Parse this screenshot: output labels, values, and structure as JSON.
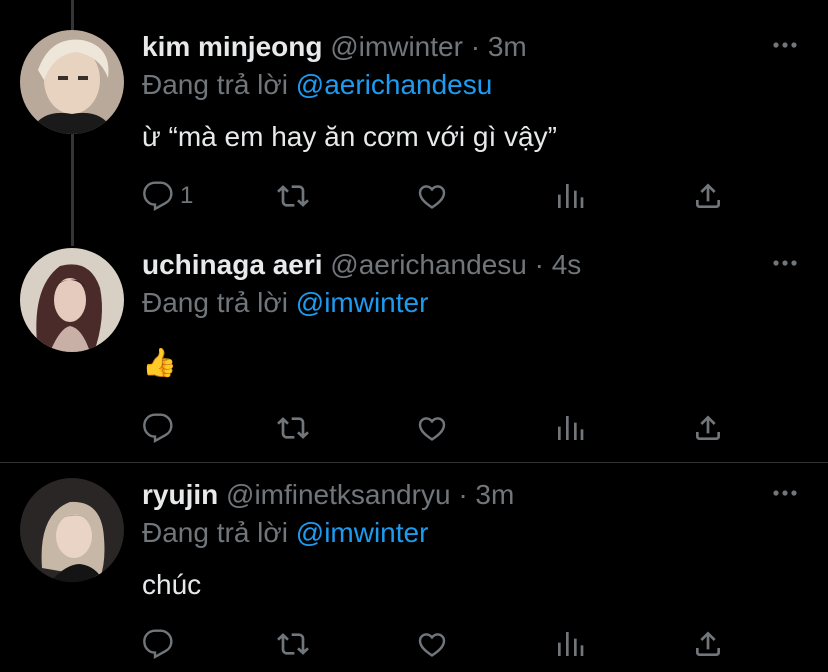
{
  "tweets": [
    {
      "name": "kim minjeong",
      "handle": "@imwinter",
      "sep": "·",
      "time": "3m",
      "reply_prefix": "Đang trả lời",
      "reply_to": "@aerichandesu",
      "text": "ừ “mà em hay ăn cơm với gì vậy”",
      "reply_count": "1"
    },
    {
      "name": "uchinaga aeri",
      "handle": "@aerichandesu",
      "sep": "·",
      "time": "4s",
      "reply_prefix": "Đang trả lời",
      "reply_to": "@imwinter",
      "text": "👍",
      "reply_count": ""
    },
    {
      "name": "ryujin",
      "handle": "@imfinetksandryu",
      "sep": "·",
      "time": "3m",
      "reply_prefix": "Đang trả lời",
      "reply_to": "@imwinter",
      "text": "chúc",
      "reply_count": ""
    }
  ],
  "colors": {
    "accent": "#1d9bf0",
    "muted": "#71767b",
    "text": "#e7e9ea",
    "bg": "#000000"
  },
  "icons": [
    "reply-icon",
    "retweet-icon",
    "like-icon",
    "analytics-icon",
    "share-icon",
    "more-icon"
  ]
}
